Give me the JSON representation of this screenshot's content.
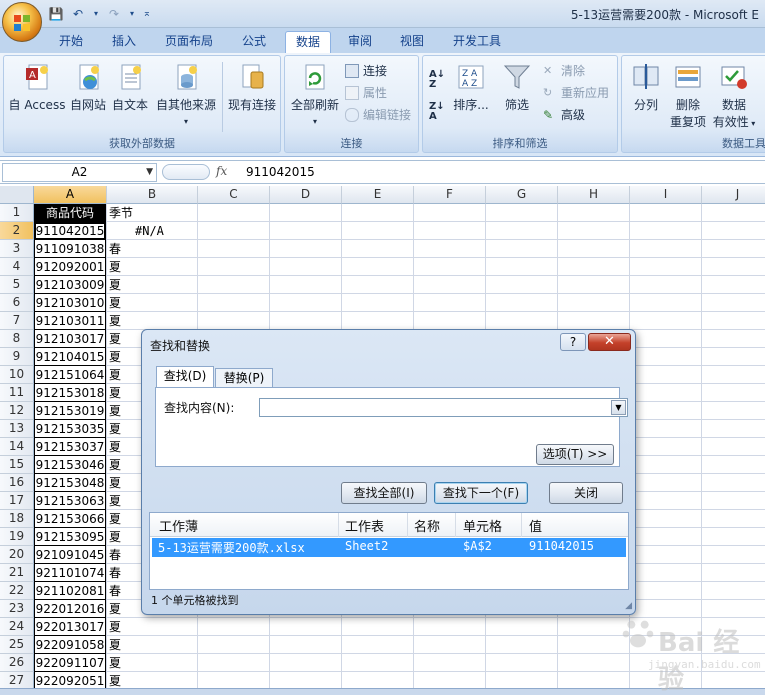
{
  "window": {
    "title": "5-13运营需要200款 - Microsoft E"
  },
  "quick_access": {
    "save_icon": "save-icon",
    "undo_icon": "undo-icon",
    "redo_icon": "redo-icon"
  },
  "ribbon_tabs": [
    "开始",
    "插入",
    "页面布局",
    "公式",
    "数据",
    "审阅",
    "视图",
    "开发工具"
  ],
  "ribbon_active_tab": "数据",
  "ribbon": {
    "get_external": {
      "label": "获取外部数据",
      "access": "自 Access",
      "web": "自网站",
      "text": "自文本",
      "other": "自其他来源",
      "existing": "现有连接"
    },
    "connections": {
      "label": "连接",
      "refresh_all": "全部刷新",
      "connections": "连接",
      "properties": "属性",
      "edit_links": "编辑链接"
    },
    "sort_filter": {
      "label": "排序和筛选",
      "sort": "排序...",
      "filter": "筛选",
      "clear": "清除",
      "reapply": "重新应用",
      "advanced": "高级"
    },
    "data_tools": {
      "label": "数据工具",
      "split": "分列",
      "remove_dup_1": "删除",
      "remove_dup_2": "重复项",
      "validation_1": "数据",
      "validation_2": "有效性"
    }
  },
  "formula_bar": {
    "name_box": "A2",
    "fx": "fx",
    "value": "911042015"
  },
  "columns": [
    "A",
    "B",
    "C",
    "D",
    "E",
    "F",
    "G",
    "H",
    "I",
    "J"
  ],
  "rows": [
    {
      "n": "1",
      "a": "商品代码",
      "b": "季节"
    },
    {
      "n": "2",
      "a": "911042015",
      "b": "#N/A"
    },
    {
      "n": "3",
      "a": "911091038",
      "b": "春"
    },
    {
      "n": "4",
      "a": "912092001",
      "b": "夏"
    },
    {
      "n": "5",
      "a": "912103009",
      "b": "夏"
    },
    {
      "n": "6",
      "a": "912103010",
      "b": "夏"
    },
    {
      "n": "7",
      "a": "912103011",
      "b": "夏"
    },
    {
      "n": "8",
      "a": "912103017",
      "b": "夏"
    },
    {
      "n": "9",
      "a": "912104015",
      "b": "夏"
    },
    {
      "n": "10",
      "a": "912151064",
      "b": "夏"
    },
    {
      "n": "11",
      "a": "912153018",
      "b": "夏"
    },
    {
      "n": "12",
      "a": "912153019",
      "b": "夏"
    },
    {
      "n": "13",
      "a": "912153035",
      "b": "夏"
    },
    {
      "n": "14",
      "a": "912153037",
      "b": "夏"
    },
    {
      "n": "15",
      "a": "912153046",
      "b": "夏"
    },
    {
      "n": "16",
      "a": "912153048",
      "b": "夏"
    },
    {
      "n": "17",
      "a": "912153063",
      "b": "夏"
    },
    {
      "n": "18",
      "a": "912153066",
      "b": "夏"
    },
    {
      "n": "19",
      "a": "912153095",
      "b": "夏"
    },
    {
      "n": "20",
      "a": "921091045",
      "b": "春"
    },
    {
      "n": "21",
      "a": "921101074",
      "b": "春"
    },
    {
      "n": "22",
      "a": "921102081",
      "b": "春"
    },
    {
      "n": "23",
      "a": "922012016",
      "b": "夏"
    },
    {
      "n": "24",
      "a": "922013017",
      "b": "夏"
    },
    {
      "n": "25",
      "a": "922091058",
      "b": "夏"
    },
    {
      "n": "26",
      "a": "922091107",
      "b": "夏"
    },
    {
      "n": "27",
      "a": "922092051",
      "b": "夏"
    }
  ],
  "dialog": {
    "title": "查找和替换",
    "help": "?",
    "close": "✕",
    "tab_find": "查找(D)",
    "tab_replace": "替换(P)",
    "find_label": "查找内容(N):",
    "find_value": "",
    "options_btn": "选项(T) >>",
    "find_all_btn": "查找全部(I)",
    "find_next_btn": "查找下一个(F)",
    "close_btn": "关闭",
    "results_headers": {
      "workbook": "工作薄",
      "sheet": "工作表",
      "name": "名称",
      "cell": "单元格",
      "value": "值"
    },
    "result": {
      "workbook": "5-13运营需要200款.xlsx",
      "sheet": "Sheet2",
      "name": "",
      "cell": "$A$2",
      "value": "911042015"
    },
    "status": "1 个单元格被找到"
  },
  "watermark": {
    "brand": "Bai 经验",
    "sub": "jingyan.baidu.com"
  }
}
